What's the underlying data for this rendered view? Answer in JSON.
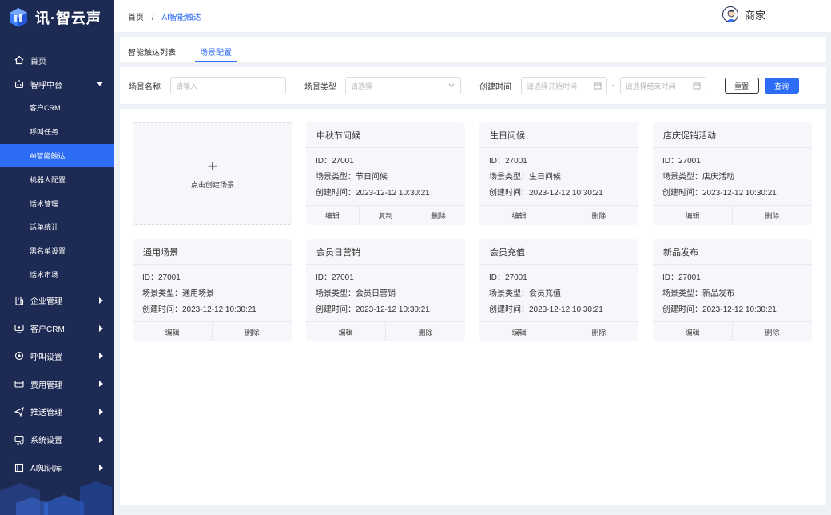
{
  "brand": {
    "name": "讯·智云声"
  },
  "sidebar": {
    "items": [
      {
        "label": "首页",
        "icon": "home-icon"
      },
      {
        "label": "智呼中台",
        "icon": "robot-icon",
        "expanded": true,
        "children": [
          "客户CRM",
          "呼叫任务",
          "AI智能触达",
          "机器人配置",
          "话术管理",
          "话单统计",
          "黑名单设置",
          "话术市场"
        ]
      },
      {
        "label": "企业管理",
        "icon": "building-icon"
      },
      {
        "label": "客户CRM",
        "icon": "monitor-user-icon"
      },
      {
        "label": "呼叫设置",
        "icon": "call-settings-icon"
      },
      {
        "label": "费用管理",
        "icon": "wallet-icon"
      },
      {
        "label": "推送管理",
        "icon": "send-icon"
      },
      {
        "label": "系统设置",
        "icon": "system-settings-icon"
      },
      {
        "label": "AI知识库",
        "icon": "book-icon"
      }
    ],
    "active_child": "AI智能触达"
  },
  "header": {
    "breadcrumb": [
      "首页",
      "AI智能触达"
    ],
    "breadcrumb_sep": "/",
    "user": "商家"
  },
  "tabs": [
    {
      "label": "智能触达列表",
      "active": false
    },
    {
      "label": "场景配置",
      "active": true
    }
  ],
  "filter": {
    "name_label": "场景名称",
    "name_placeholder": "请输入",
    "type_label": "场景类型",
    "type_placeholder": "请选择",
    "time_label": "创建时间",
    "start_placeholder": "请选择开始时间",
    "range_sep": "-",
    "end_placeholder": "请选择结束时间",
    "reset": "重置",
    "query": "查询"
  },
  "create_card": {
    "label": "点击创建场景",
    "plus": "+"
  },
  "scenes": [
    {
      "title": "中秋节问候",
      "id": "ID：27001",
      "type": "场景类型：节日问候",
      "time": "创建时间：2023-12-12 10:30:21",
      "actions": [
        "编辑",
        "复制",
        "删除"
      ]
    },
    {
      "title": "生日问候",
      "id": "ID：27001",
      "type": "场景类型：生日问候",
      "time": "创建时间：2023-12-12 10:30:21",
      "actions": [
        "编辑",
        "删除"
      ]
    },
    {
      "title": "店庆促销活动",
      "id": "ID：27001",
      "type": "场景类型：店庆活动",
      "time": "创建时间：2023-12-12 10:30:21",
      "actions": [
        "编辑",
        "删除"
      ]
    },
    {
      "title": "通用场景",
      "id": "ID：27001",
      "type": "场景类型：通用场景",
      "time": "创建时间：2023-12-12 10:30:21",
      "actions": [
        "编辑",
        "删除"
      ]
    },
    {
      "title": "会员日营销",
      "id": "ID：27001",
      "type": "场景类型：会员日营销",
      "time": "创建时间：2023-12-12 10:30:21",
      "actions": [
        "编辑",
        "删除"
      ]
    },
    {
      "title": "会员充值",
      "id": "ID：27001",
      "type": "场景类型：会员充值",
      "time": "创建时间：2023-12-12 10:30:21",
      "actions": [
        "编辑",
        "删除"
      ]
    },
    {
      "title": "新品发布",
      "id": "ID：27001",
      "type": "场景类型：新品发布",
      "time": "创建时间：2023-12-12 10:30:21",
      "actions": [
        "编辑",
        "删除"
      ]
    }
  ],
  "colors": {
    "sidebar_bg": "#1d2a53",
    "accent": "#2d6cf5",
    "page_bg": "#eef1f6",
    "card_bg": "#f6f7fa"
  }
}
